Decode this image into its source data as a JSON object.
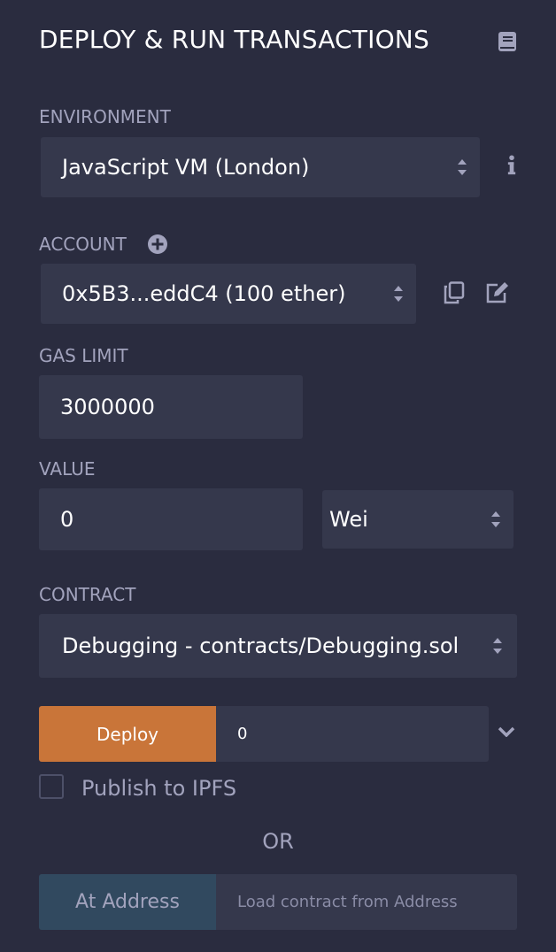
{
  "header": {
    "title": "DEPLOY & RUN TRANSACTIONS",
    "doc_icon": "book-icon"
  },
  "environment": {
    "label": "ENVIRONMENT",
    "value": "JavaScript VM (London)",
    "info_icon": "info-icon"
  },
  "account": {
    "label": "ACCOUNT",
    "add_icon": "plus-circle-icon",
    "value": "0x5B3...eddC4 (100 ether)",
    "copy_icon": "copy-icon",
    "edit_icon": "edit-icon"
  },
  "gas_limit": {
    "label": "GAS LIMIT",
    "value": "3000000"
  },
  "value": {
    "label": "VALUE",
    "amount": "0",
    "unit": "Wei"
  },
  "contract": {
    "label": "CONTRACT",
    "value": "Debugging - contracts/Debugging.sol"
  },
  "deploy": {
    "button_label": "Deploy",
    "input_value": "0",
    "chevron_icon": "chevron-down-icon"
  },
  "publish": {
    "label": "Publish to IPFS",
    "checked": false
  },
  "divider_text": "OR",
  "at_address": {
    "button_label": "At Address",
    "placeholder": "Load contract from Address"
  },
  "colors": {
    "background": "#2a2c3f",
    "field": "#35384c",
    "label": "#a2a3bd",
    "deploy": "#c97539",
    "at_address": "#31495f"
  }
}
